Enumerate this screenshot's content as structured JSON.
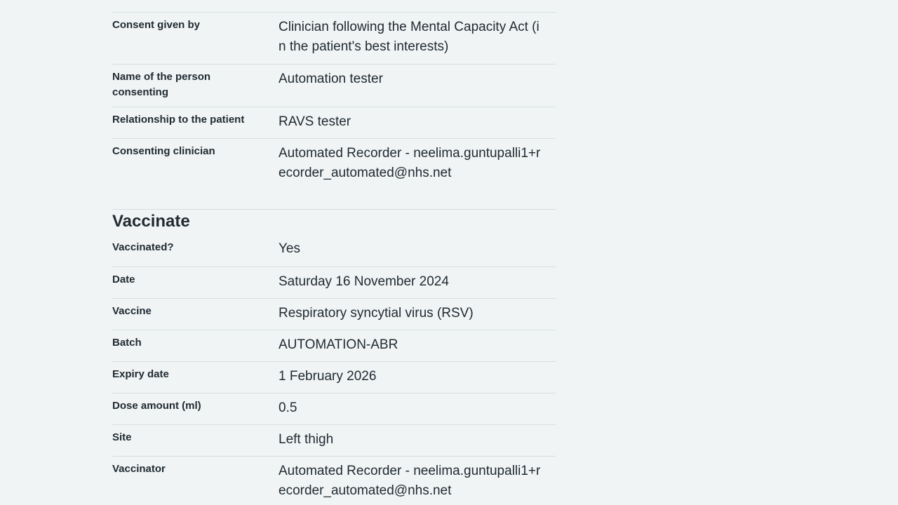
{
  "consent": {
    "rows": [
      {
        "key": "Consent given by",
        "value": "Clinician following the Mental Capacity Act (in the patient's best interests)"
      },
      {
        "key": "Name of the person consenting",
        "value": "Automation tester"
      },
      {
        "key": "Relationship to the patient",
        "value": "RAVS tester"
      },
      {
        "key": "Consenting clinician",
        "value": "Automated Recorder - neelima.guntupalli1+recorder_automated@nhs.net"
      }
    ]
  },
  "vaccinate": {
    "heading": "Vaccinate",
    "rows": [
      {
        "key": "Vaccinated?",
        "value": "Yes"
      },
      {
        "key": "Date",
        "value": "Saturday 16 November 2024"
      },
      {
        "key": "Vaccine",
        "value": "Respiratory syncytial virus (RSV)"
      },
      {
        "key": "Batch",
        "value": "AUTOMATION-ABR"
      },
      {
        "key": "Expiry date",
        "value": "1 February 2026"
      },
      {
        "key": "Dose amount (ml)",
        "value": "0.5"
      },
      {
        "key": "Site",
        "value": "Left thigh"
      },
      {
        "key": "Vaccinator",
        "value": "Automated Recorder - neelima.guntupalli1+recorder_automated@nhs.net"
      }
    ]
  }
}
